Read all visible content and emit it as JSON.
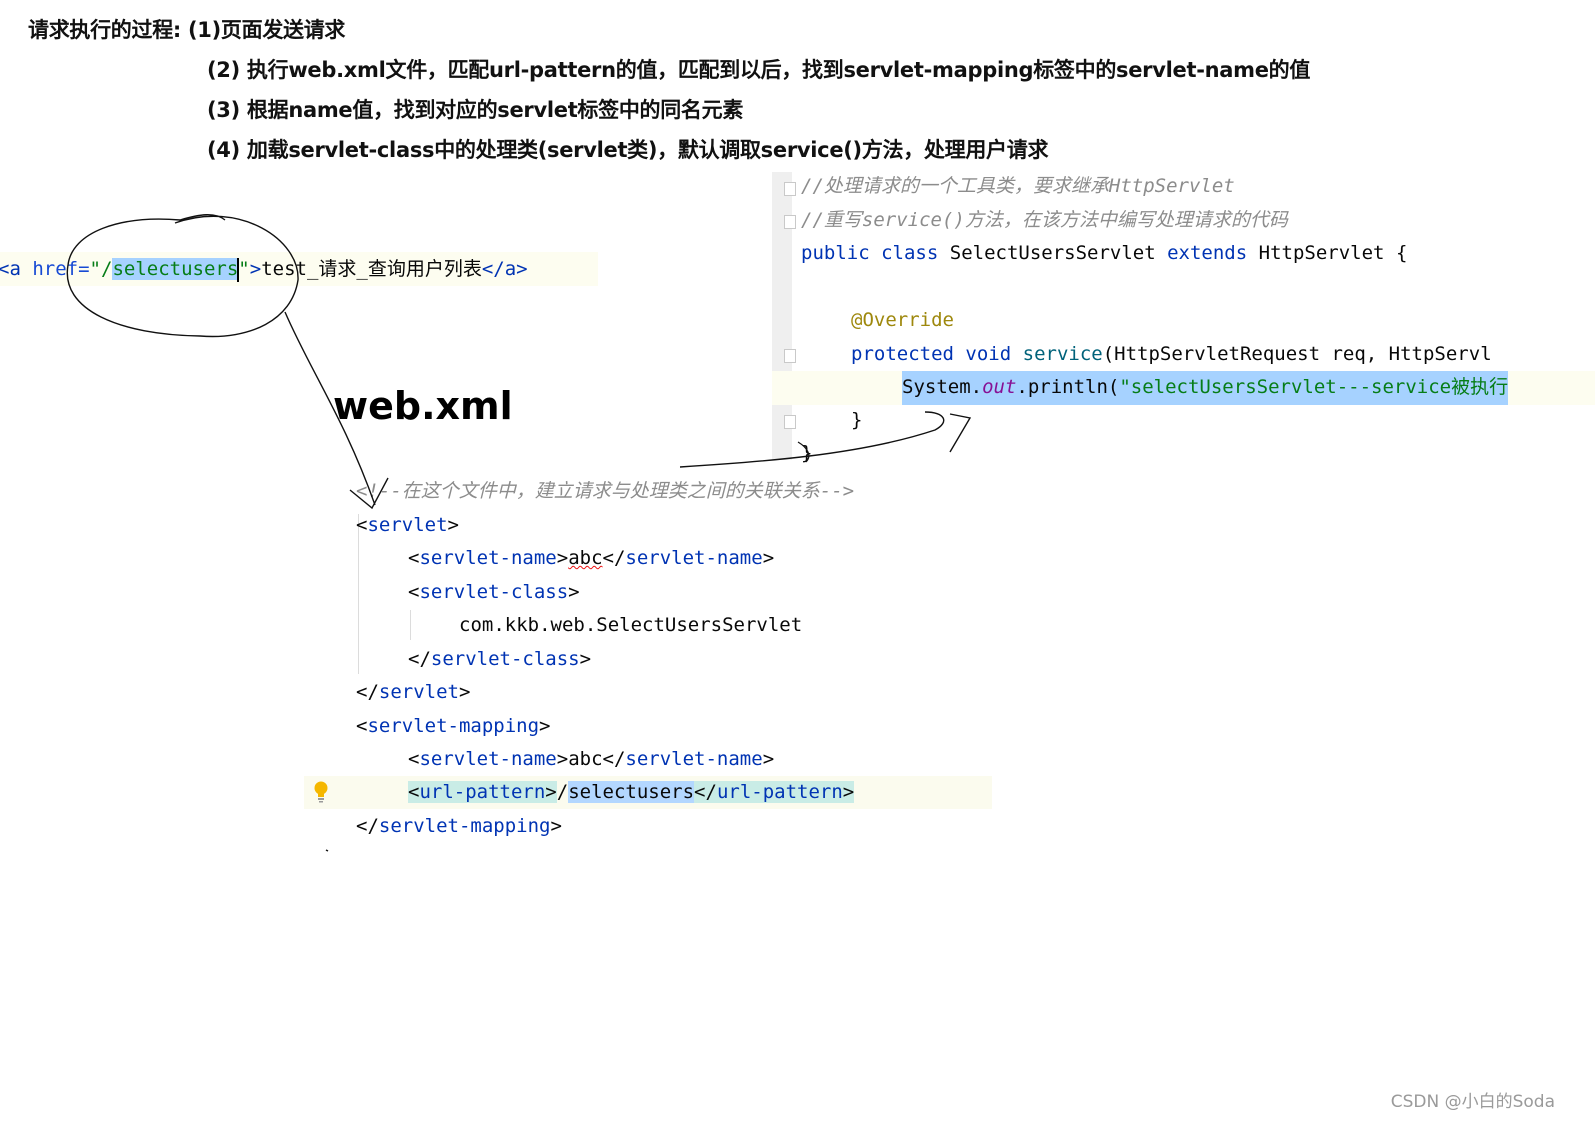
{
  "headings": {
    "line1": "请求执行的过程: (1)页面发送请求",
    "line2": "(2) 执行web.xml文件，匹配url-pattern的值，匹配到以后，找到servlet-mapping标签中的servlet-name的值",
    "line3": "(3) 根据name值，找到对应的servlet标签中的同名元素",
    "line4": "(4) 加载servlet-class中的处理类(servlet类)，默认调取service()方法，处理用户请求"
  },
  "anchor": {
    "open": "<a",
    "attr": "href=",
    "quote_open": "\"/",
    "url": "selectusers",
    "quote_close": "\"",
    "gt": ">",
    "text": "test_请求_查询用户列表",
    "close": "</a>"
  },
  "java": {
    "comment1": "//处理请求的一个工具类，要求继承HttpServlet",
    "comment2": "//重写service()方法，在该方法中编写处理请求的代码",
    "kw_public": "public",
    "kw_class": "class",
    "class_name": "SelectUsersServlet",
    "kw_extends": "extends",
    "super_name": "HttpServlet",
    "brace_open": "{",
    "annotation": "@Override",
    "kw_protected": "protected",
    "kw_void": "void",
    "method_name": "service",
    "params": "(HttpServletRequest req, HttpServl",
    "print_obj": "System.",
    "print_field": "out",
    "print_call": ".println(",
    "print_str": "\"selectUsersServlet---service被执行",
    "inner_close": "}",
    "outer_close": "}"
  },
  "web_xml_label": "web.xml",
  "xml": {
    "comment": "<!--在这个文件中，建立请求与处理类之间的关联关系-->",
    "servlet_tag": "servlet",
    "servlet_name_tag": "servlet-name",
    "servlet_name_value": "abc",
    "servlet_class_tag": "servlet-class",
    "servlet_class_value": "com.kkb.web.SelectUsersServlet",
    "servlet_mapping_tag": "servlet-mapping",
    "mapping_name_value": "abc",
    "url_pattern_tag": "url-pattern",
    "url_slash": "/",
    "url_value": "selectusers"
  },
  "watermark": "CSDN @小白的Soda",
  "icons": {
    "bulb": "lightbulb-icon",
    "fold": "fold-marker-icon"
  },
  "colors": {
    "keyword": "#0033b3",
    "string": "#067d17",
    "comment": "#8c8c8c",
    "annotation": "#9e880d",
    "selection": "#a6d2ff"
  }
}
